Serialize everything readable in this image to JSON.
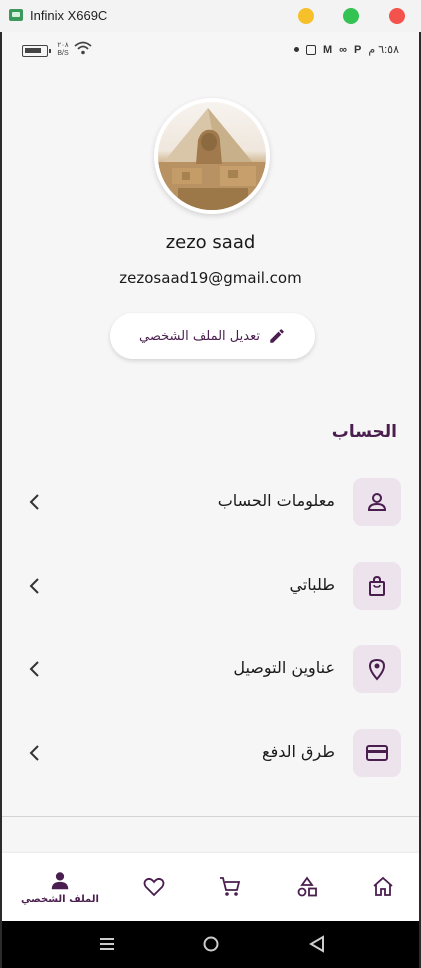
{
  "window": {
    "title": "Infinix X669C"
  },
  "status_bar": {
    "net_speed_value": "٢٠٨",
    "net_speed_unit": "B/S",
    "time": "٦:٥٨ م"
  },
  "profile": {
    "name": "zezo saad",
    "email": "zezosaad19@gmail.com",
    "edit_button_label": "تعديل الملف الشخصي"
  },
  "account_section": {
    "title": "الحساب",
    "items": [
      {
        "label": "معلومات الحساب",
        "icon": "person-icon"
      },
      {
        "label": "طلباتي",
        "icon": "shopping-bag-icon"
      },
      {
        "label": "عناوين التوصيل",
        "icon": "location-pin-icon"
      },
      {
        "label": "طرق الدفع",
        "icon": "credit-card-icon"
      }
    ]
  },
  "bottom_nav": {
    "items": [
      {
        "label": "",
        "icon": "home-icon",
        "active": false
      },
      {
        "label": "",
        "icon": "categories-icon",
        "active": false
      },
      {
        "label": "",
        "icon": "cart-icon",
        "active": false
      },
      {
        "label": "",
        "icon": "heart-icon",
        "active": false
      },
      {
        "label": "الملف الشخصي",
        "icon": "person-icon",
        "active": true
      }
    ]
  },
  "colors": {
    "accent": "#4a1f4f",
    "icon_tile": "#ece3ed",
    "background": "#f7f6f7"
  }
}
